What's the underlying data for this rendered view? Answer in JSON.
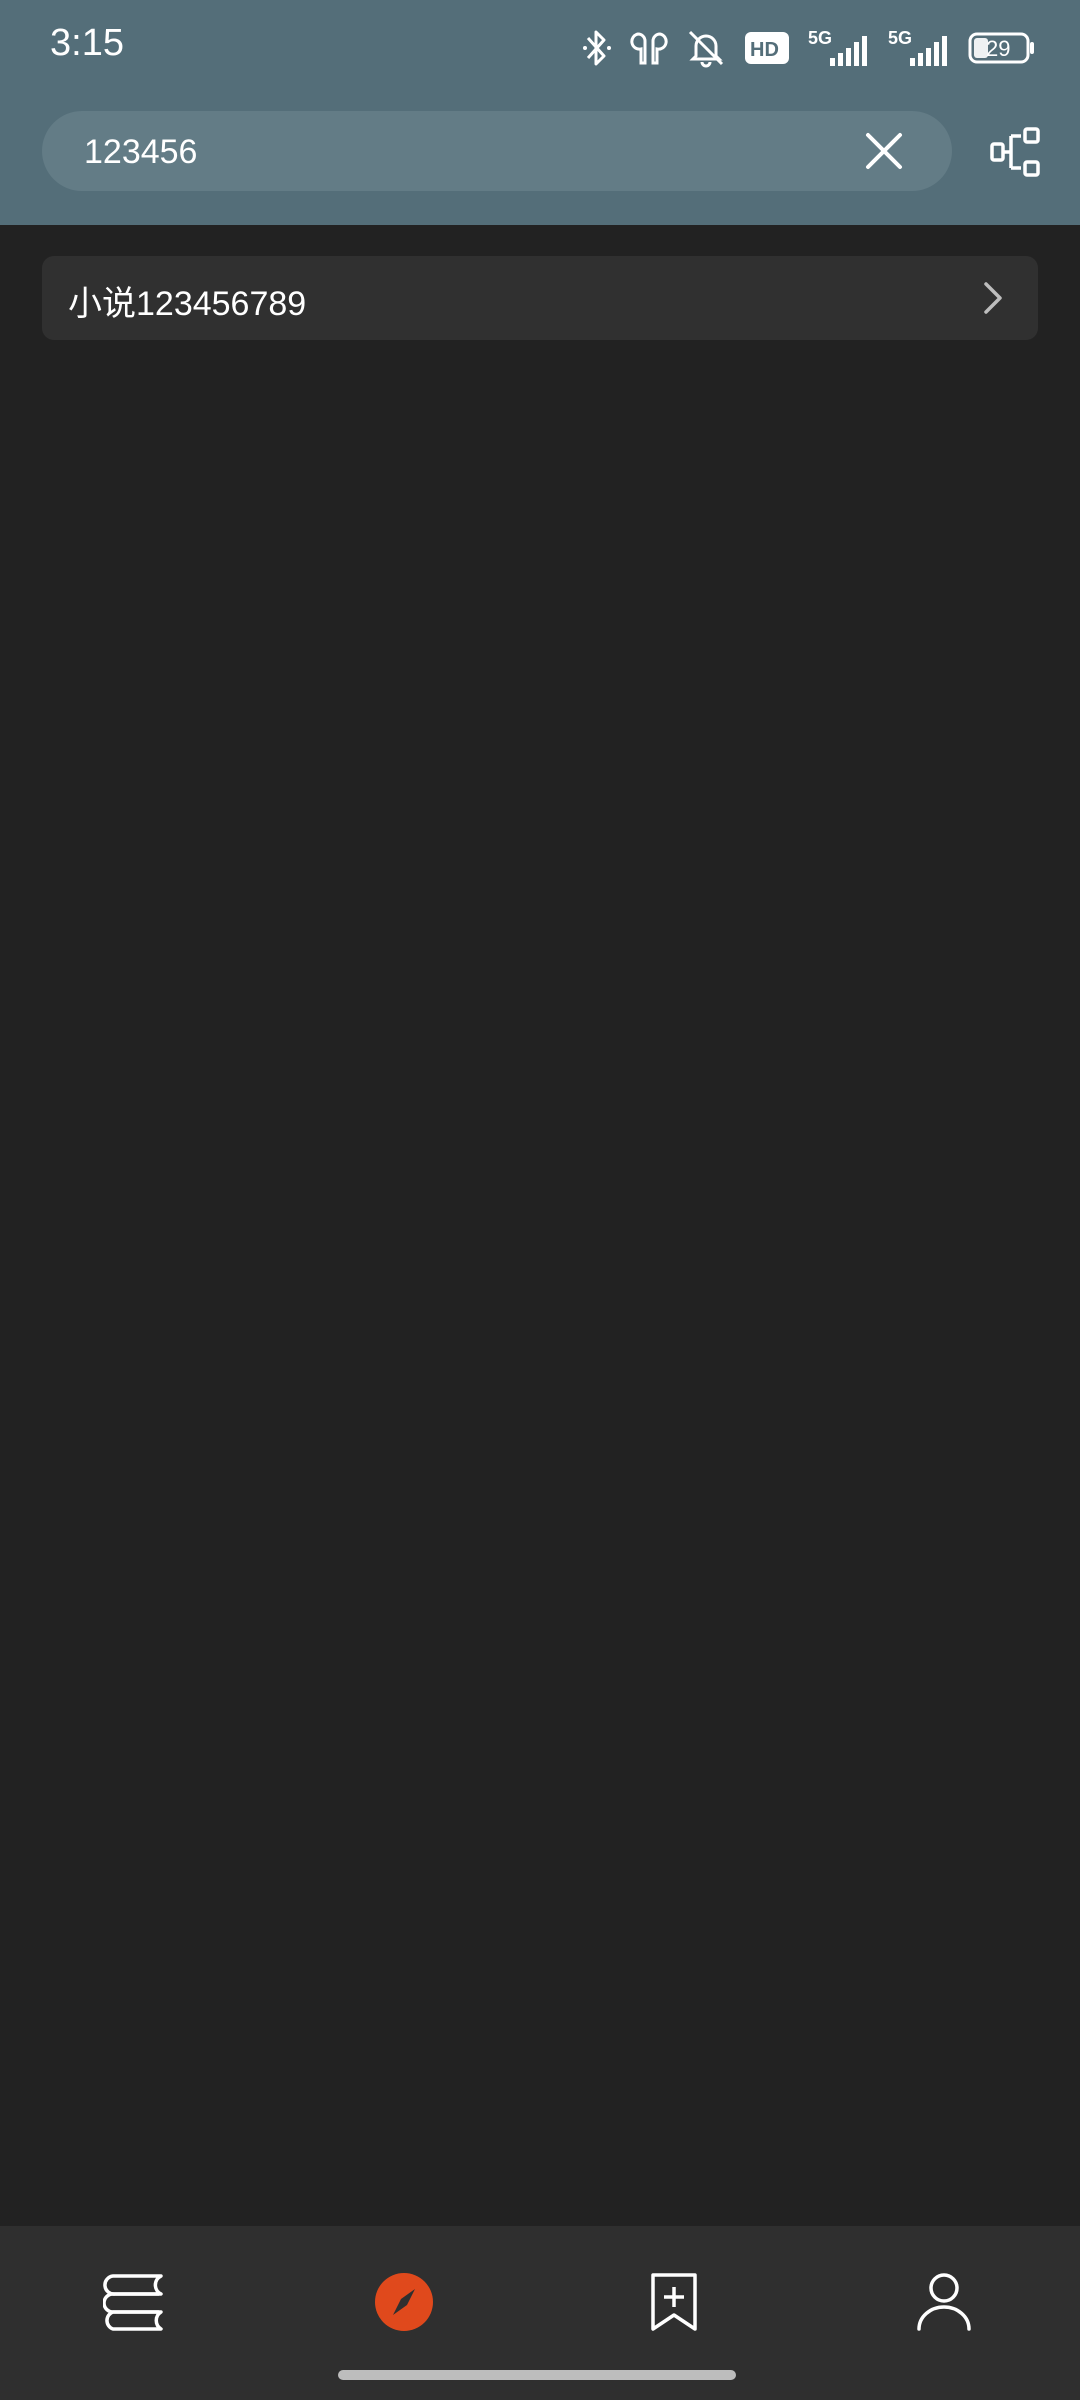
{
  "status_bar": {
    "time": "3:15",
    "battery": "29",
    "network_1": "5G",
    "network_2": "5G",
    "hd_badge": "HD",
    "icons": [
      "bluetooth-icon",
      "earbuds-icon",
      "bell-muted-icon",
      "hd-icon",
      "signal-icon",
      "signal-icon",
      "battery-icon"
    ]
  },
  "search": {
    "value": "123456",
    "clear_icon": "close-icon",
    "flow_icon": "source-flow-icon"
  },
  "results": [
    {
      "label": "小说123456789",
      "icon": "chevron-right-icon"
    }
  ],
  "bottom_nav": {
    "items": [
      {
        "icon": "bookshelf-icon",
        "active": false
      },
      {
        "icon": "compass-icon",
        "active": true
      },
      {
        "icon": "bookmark-add-icon",
        "active": false
      },
      {
        "icon": "profile-icon",
        "active": false
      }
    ],
    "accent_color": "#E0491C"
  },
  "colors": {
    "header": "#546E79",
    "search_pill": "#637C86",
    "background": "#222222",
    "card": "#303030",
    "nav": "#2F2F2F"
  }
}
